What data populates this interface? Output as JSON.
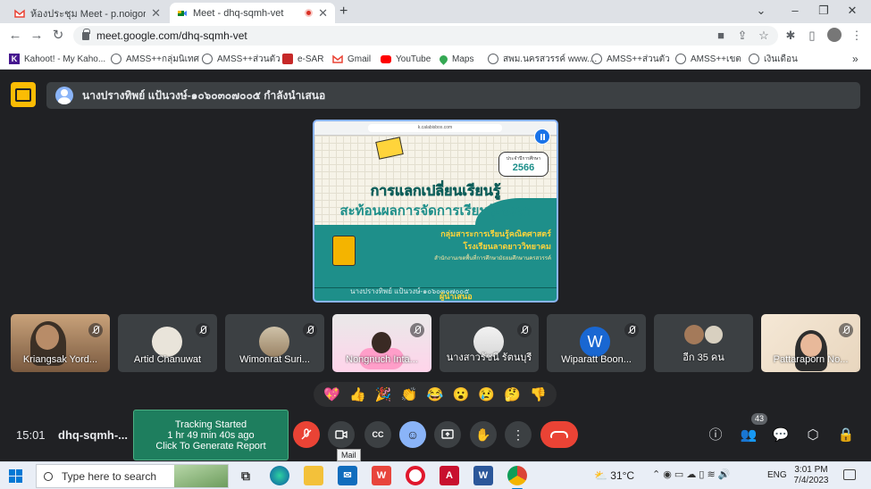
{
  "browser": {
    "tabs": [
      {
        "title": "ห้องประชุม Meet - p.noigor@gmail",
        "active": false
      },
      {
        "title": "Meet - dhq-sqmh-vet",
        "active": true,
        "recording": true
      }
    ],
    "new_tab": "+",
    "window_controls": {
      "tab_search": "⌄",
      "minimize": "–",
      "restore": "❐",
      "close": "✕"
    },
    "url": "meet.google.com/dhq-sqmh-vet",
    "bookmarks": [
      {
        "label": "Kahoot! - My Kaho...",
        "icon": "kahoot-icon"
      },
      {
        "label": "AMSS++กลุ่มนิเทศ",
        "icon": "globe-icon"
      },
      {
        "label": "AMSS++ส่วนตัว",
        "icon": "globe-icon"
      },
      {
        "label": "e-SAR",
        "icon": "esar-icon"
      },
      {
        "label": "Gmail",
        "icon": "gmail-icon"
      },
      {
        "label": "YouTube",
        "icon": "youtube-icon"
      },
      {
        "label": "Maps",
        "icon": "maps-icon"
      },
      {
        "label": "สพม.นครสวรรค์ www....",
        "icon": "globe-icon"
      },
      {
        "label": "AMSS++ส่วนตัว",
        "icon": "globe-icon"
      },
      {
        "label": "AMSS++เขต",
        "icon": "globe-icon"
      },
      {
        "label": "เงินเดือน",
        "icon": "globe-icon"
      }
    ],
    "bookmarks_overflow": "»"
  },
  "meet": {
    "presenter_banner": "นางปรางทิพย์ แป้นวงษ์-๑๐๖๐๓๐๗๐๐๕ กำลังนำเสนอ",
    "slide": {
      "url_text": "k.calabisbox.com",
      "badge_top": "ประจำปีการศึกษา",
      "badge_year": "2566",
      "title_line1": "การแลกเปลี่ยนเรียนรู้",
      "title_line2": "สะท้อนผลการจัดการเรียนรู้เชิงรุก",
      "sub_line1": "กลุ่มสาระการเรียนรู้คณิตศาสตร์",
      "sub_line2": "โรงเรียนลาดยาววิทยาคม",
      "sub_line3": "สำนักงานเขตพื้นที่การศึกษามัธยมศึกษานครสวรรค์",
      "presenter_overlay": "นางปรางทิพย์ แป้นวงษ์-๑๐๖๐๓๐๗๐๐๕",
      "caption": "ผู้นำเสนอ"
    },
    "participants": [
      {
        "name": "Kriangsak Yord...",
        "type": "photo"
      },
      {
        "name": "Artid Chanuwat",
        "type": "avatar"
      },
      {
        "name": "Wimonrat Suri...",
        "type": "avatar"
      },
      {
        "name": "Nongnuch Inta...",
        "type": "camera"
      },
      {
        "name": "นางสาวรัชนี รัตนบุรี",
        "type": "avatar"
      },
      {
        "name": "Wiparatt Boon...",
        "type": "letter",
        "letter": "W"
      },
      {
        "name": "อีก 35 คน",
        "type": "group"
      },
      {
        "name": "Pattaraporn No...",
        "type": "camera"
      }
    ],
    "reactions": [
      "💖",
      "👍",
      "🎉",
      "👏",
      "😂",
      "😮",
      "😢",
      "🤔",
      "👎"
    ],
    "clock": "15:01",
    "meeting_code": "dhq-sqmh-...",
    "tracking": {
      "line1": "Tracking Started",
      "line2": "1 hr 49 min 40s ago",
      "line3": "Click To Generate Report"
    },
    "tooltip": "Mail",
    "people_count": "43"
  },
  "taskbar": {
    "search_placeholder": "Type here to search",
    "weather": "31°C",
    "language": "ENG",
    "time": "3:01 PM",
    "date": "7/4/2023"
  },
  "colors": {
    "meet_bg": "#202124",
    "tile_bg": "#3c4043",
    "end_call": "#ea4335",
    "present_accent": "#fbbc04",
    "tracking_bg": "#1e7e5e"
  }
}
